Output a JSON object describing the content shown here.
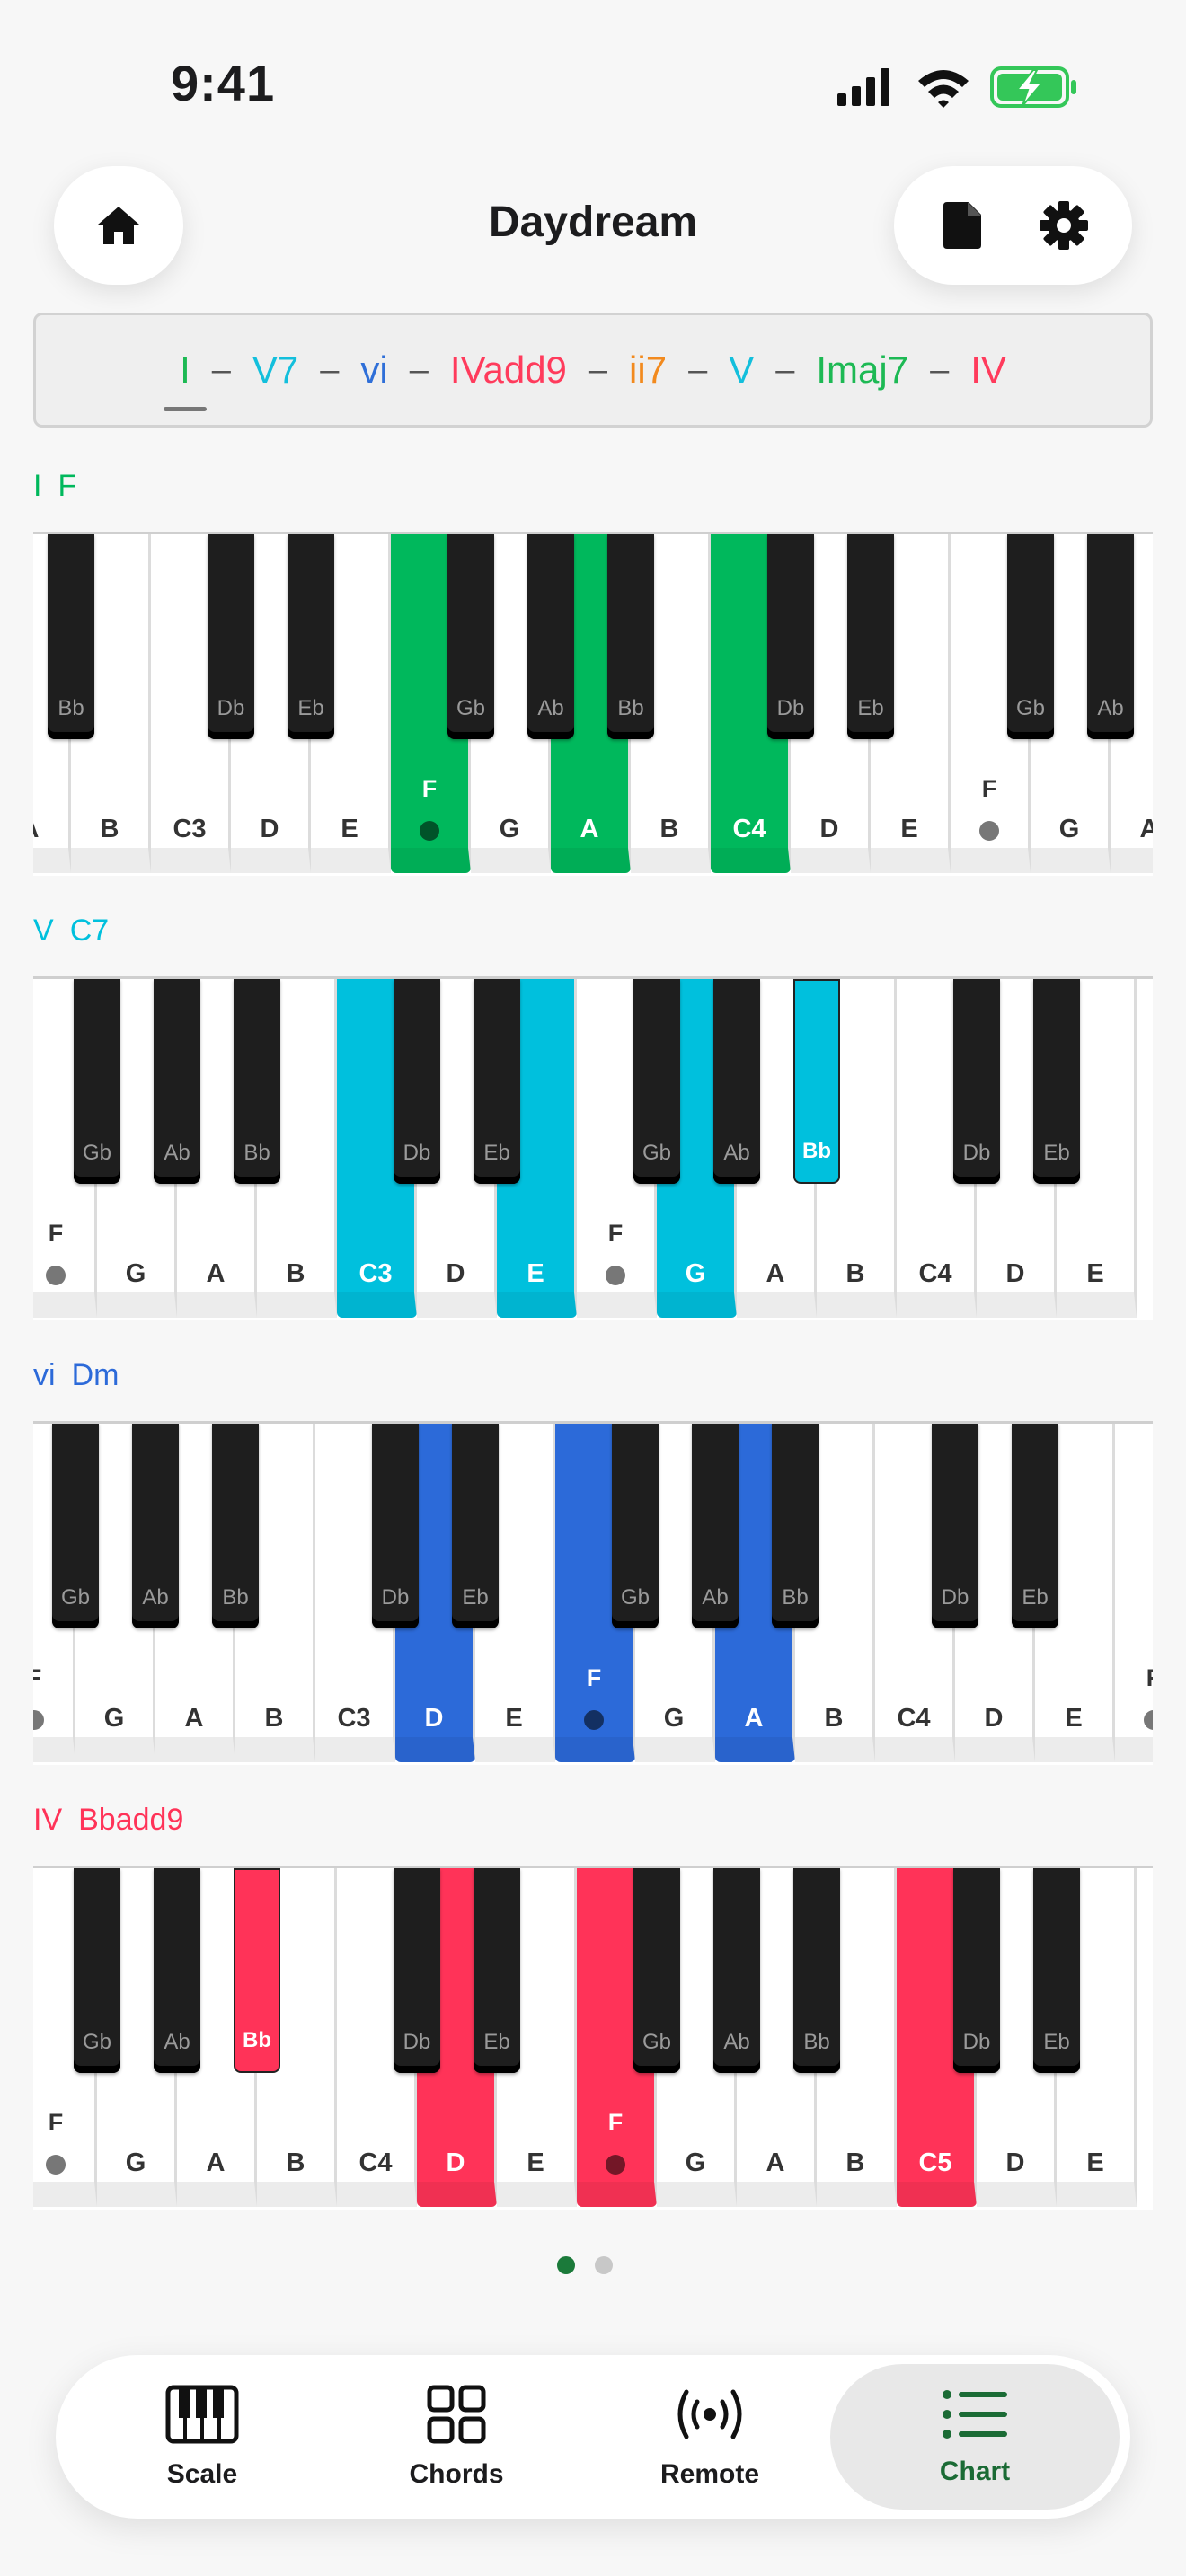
{
  "status": {
    "time": "9:41"
  },
  "header": {
    "title": "Daydream"
  },
  "progression": [
    {
      "label": "I",
      "color": "#1db954",
      "selected": true
    },
    {
      "label": "V7",
      "color": "#13bfdc"
    },
    {
      "label": "vi",
      "color": "#2f6fd8"
    },
    {
      "label": "IVadd9",
      "color": "#ff3b5c"
    },
    {
      "label": "ii7",
      "color": "#f28a1e"
    },
    {
      "label": "V",
      "color": "#13bfdc"
    },
    {
      "label": "Imaj7",
      "color": "#1db954"
    },
    {
      "label": "IV",
      "color": "#ff3b5c"
    }
  ],
  "separator": "–",
  "sections": [
    {
      "numeral": "I",
      "name": "F",
      "color": "#00b85c",
      "whites": [
        {
          "n": "A"
        },
        {
          "n": "B"
        },
        {
          "n": "C3"
        },
        {
          "n": "D"
        },
        {
          "n": "E"
        },
        {
          "n": "",
          "f": "F",
          "hl": true,
          "dot": true
        },
        {
          "n": "G"
        },
        {
          "n": "A",
          "hl": true
        },
        {
          "n": "B"
        },
        {
          "n": "C4",
          "hl": true
        },
        {
          "n": "D"
        },
        {
          "n": "E"
        },
        {
          "n": "",
          "f": "F",
          "dot": true
        },
        {
          "n": "G"
        },
        {
          "n": "A"
        }
      ],
      "blacks": [
        {
          "after": 0,
          "n": "Bb"
        },
        {
          "after": 2,
          "n": "Db"
        },
        {
          "after": 3,
          "n": "Eb"
        },
        {
          "after": 5,
          "n": "Gb"
        },
        {
          "after": 6,
          "n": "Ab"
        },
        {
          "after": 7,
          "n": "Bb"
        },
        {
          "after": 9,
          "n": "Db"
        },
        {
          "after": 10,
          "n": "Eb"
        },
        {
          "after": 12,
          "n": "Gb"
        },
        {
          "after": 13,
          "n": "Ab"
        }
      ]
    },
    {
      "numeral": "V",
      "name": "C7",
      "color": "#00c0dd",
      "whites": [
        {
          "n": "",
          "f": "F",
          "dot": true
        },
        {
          "n": "G"
        },
        {
          "n": "A"
        },
        {
          "n": "B"
        },
        {
          "n": "C3",
          "hl": true
        },
        {
          "n": "D"
        },
        {
          "n": "E",
          "hl": true
        },
        {
          "n": "",
          "f": "F",
          "dot": true
        },
        {
          "n": "G",
          "hl": true
        },
        {
          "n": "A"
        },
        {
          "n": "B"
        },
        {
          "n": "C4"
        },
        {
          "n": "D"
        },
        {
          "n": "E"
        }
      ],
      "blacks": [
        {
          "after": 0,
          "n": "Gb"
        },
        {
          "after": 1,
          "n": "Ab"
        },
        {
          "after": 2,
          "n": "Bb"
        },
        {
          "after": 4,
          "n": "Db"
        },
        {
          "after": 5,
          "n": "Eb"
        },
        {
          "after": 7,
          "n": "Gb"
        },
        {
          "after": 8,
          "n": "Ab"
        },
        {
          "after": 9,
          "n": "Bb",
          "hl": true
        },
        {
          "after": 11,
          "n": "Db"
        },
        {
          "after": 12,
          "n": "Eb"
        }
      ]
    },
    {
      "numeral": "vi",
      "name": "Dm",
      "color": "#2c6ad9",
      "whites": [
        {
          "n": "",
          "f": "F",
          "dot": true
        },
        {
          "n": "G"
        },
        {
          "n": "A"
        },
        {
          "n": "B"
        },
        {
          "n": "C3"
        },
        {
          "n": "D",
          "hl": true
        },
        {
          "n": "E"
        },
        {
          "n": "",
          "f": "F",
          "hl": true,
          "dot": true
        },
        {
          "n": "G"
        },
        {
          "n": "A",
          "hl": true
        },
        {
          "n": "B"
        },
        {
          "n": "C4"
        },
        {
          "n": "D"
        },
        {
          "n": "E"
        },
        {
          "n": "",
          "f": "F",
          "dot": true
        }
      ],
      "blacks": [
        {
          "after": 0,
          "n": "Gb"
        },
        {
          "after": 1,
          "n": "Ab"
        },
        {
          "after": 2,
          "n": "Bb"
        },
        {
          "after": 4,
          "n": "Db"
        },
        {
          "after": 5,
          "n": "Eb"
        },
        {
          "after": 7,
          "n": "Gb"
        },
        {
          "after": 8,
          "n": "Ab"
        },
        {
          "after": 9,
          "n": "Bb"
        },
        {
          "after": 11,
          "n": "Db"
        },
        {
          "after": 12,
          "n": "Eb"
        }
      ]
    },
    {
      "numeral": "IV",
      "name": "Bbadd9",
      "color": "#ff3358",
      "whites": [
        {
          "n": "",
          "f": "F",
          "dot": true
        },
        {
          "n": "G"
        },
        {
          "n": "A"
        },
        {
          "n": "B"
        },
        {
          "n": "C4"
        },
        {
          "n": "D",
          "hl": true
        },
        {
          "n": "E"
        },
        {
          "n": "",
          "f": "F",
          "hl": true,
          "dot": true
        },
        {
          "n": "G"
        },
        {
          "n": "A"
        },
        {
          "n": "B"
        },
        {
          "n": "C5",
          "hl": true
        },
        {
          "n": "D"
        },
        {
          "n": "E"
        }
      ],
      "blacks": [
        {
          "after": 0,
          "n": "Gb"
        },
        {
          "after": 1,
          "n": "Ab"
        },
        {
          "after": 2,
          "n": "Bb",
          "hl": true
        },
        {
          "after": 4,
          "n": "Db"
        },
        {
          "after": 5,
          "n": "Eb"
        },
        {
          "after": 7,
          "n": "Gb"
        },
        {
          "after": 8,
          "n": "Ab"
        },
        {
          "after": 9,
          "n": "Bb"
        },
        {
          "after": 11,
          "n": "Db"
        },
        {
          "after": 12,
          "n": "Eb"
        }
      ]
    }
  ],
  "pager": {
    "count": 2,
    "active": 0
  },
  "tabs": [
    {
      "label": "Scale",
      "icon": "piano-icon"
    },
    {
      "label": "Chords",
      "icon": "grid-icon"
    },
    {
      "label": "Remote",
      "icon": "broadcast-icon"
    },
    {
      "label": "Chart",
      "icon": "list-icon",
      "active": true
    }
  ],
  "colors": {
    "accent": "#1b6b35",
    "battery": "#34c759"
  }
}
